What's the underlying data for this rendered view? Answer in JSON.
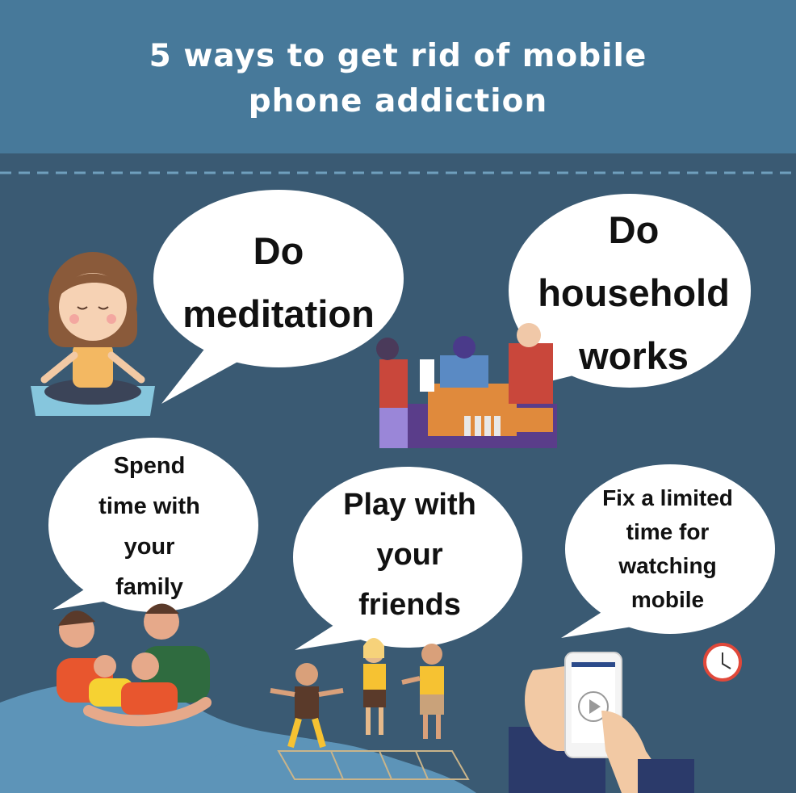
{
  "title": {
    "line1": "5 ways to get rid of mobile",
    "line2": "phone addiction"
  },
  "tips": [
    {
      "lines": [
        "Do",
        "meditation"
      ],
      "icon": "meditating-girl-icon"
    },
    {
      "lines": [
        "Do",
        "household",
        "works"
      ],
      "icon": "household-work-icon"
    },
    {
      "lines": [
        "Spend",
        "time with",
        "your",
        "family"
      ],
      "icon": "family-hug-icon"
    },
    {
      "lines": [
        "Play with",
        "your",
        "friends"
      ],
      "icon": "kids-playing-icon"
    },
    {
      "lines": [
        "Fix a limited",
        "time for",
        "watching",
        "mobile"
      ],
      "icon": "hand-phone-icon"
    }
  ],
  "colors": {
    "header": "#47799a",
    "background": "#3a5a73",
    "wave": "#5d94b8",
    "bubble": "#ffffff",
    "text": "#111111"
  }
}
